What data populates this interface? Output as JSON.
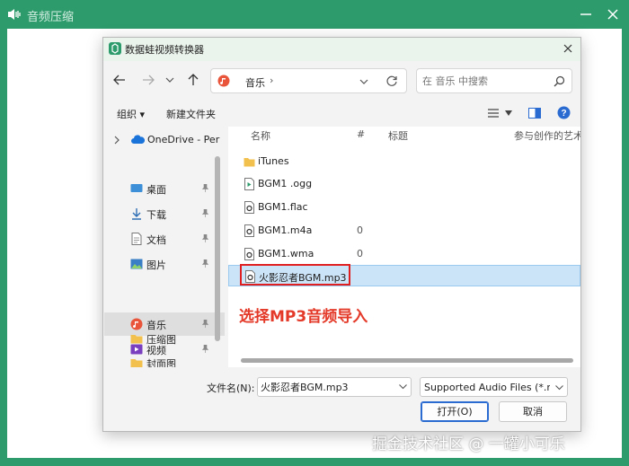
{
  "app": {
    "title": "音频压缩",
    "accent": "#2e9b6c"
  },
  "dialog": {
    "title": "数据蛙视频转换器",
    "address": {
      "location": "音乐",
      "separator": "›"
    },
    "search": {
      "placeholder": "在 音乐 中搜索"
    },
    "commands": {
      "organize": "组织 ▾",
      "new_folder": "新建文件夹"
    },
    "nav_items": [
      {
        "label": "OneDrive - Per",
        "icon": "onedrive-icon"
      },
      {
        "label": "桌面",
        "icon": "desktop-icon",
        "pinned": true
      },
      {
        "label": "下载",
        "icon": "download-icon",
        "pinned": true
      },
      {
        "label": "文档",
        "icon": "documents-icon",
        "pinned": true
      },
      {
        "label": "图片",
        "icon": "pictures-icon",
        "pinned": true
      },
      {
        "label": "音乐",
        "icon": "music-icon",
        "pinned": true,
        "selected": true
      },
      {
        "label": "视频",
        "icon": "video-icon",
        "pinned": true
      },
      {
        "label": "压缩图",
        "icon": "folder-icon"
      },
      {
        "label": "封面图",
        "icon": "folder-icon"
      }
    ],
    "columns": {
      "name": "名称",
      "number": "#",
      "title": "标题",
      "artist": "参与创作的艺术家"
    },
    "files": [
      {
        "name": "iTunes",
        "type": "folder",
        "num": ""
      },
      {
        "name": "BGM1 .ogg",
        "type": "audio-play",
        "num": ""
      },
      {
        "name": "BGM1.flac",
        "type": "audio",
        "num": ""
      },
      {
        "name": "BGM1.m4a",
        "type": "audio",
        "num": "0"
      },
      {
        "name": "BGM1.wma",
        "type": "audio",
        "num": "0"
      },
      {
        "name": "火影忍者BGM.mp3",
        "type": "audio",
        "num": "",
        "selected": true
      }
    ],
    "annotation": "选择MP3音频导入",
    "filename_label": "文件名(N):",
    "filename_value": "火影忍者BGM.mp3",
    "filter": "Supported Audio Files (*.mp",
    "open_label": "打开(O)",
    "cancel_label": "取消"
  },
  "watermark": "掘金技术社区 @ 一罐小可乐"
}
